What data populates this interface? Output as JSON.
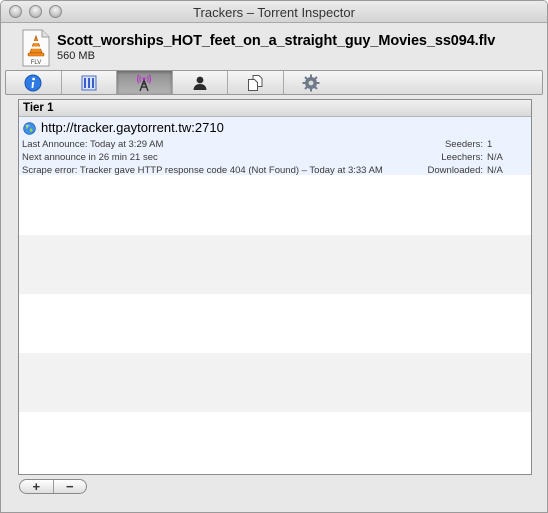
{
  "window": {
    "title": "Trackers – Torrent Inspector"
  },
  "file": {
    "icon": "flv-file-icon",
    "icon_label": "FLV",
    "name": "Scott_worships_HOT_feet_on_a_straight_guy_Movies_ss094.flv",
    "size": "560 MB"
  },
  "tabs": [
    {
      "icon": "info-icon",
      "selected": false
    },
    {
      "icon": "pieces-icon",
      "selected": false
    },
    {
      "icon": "tracker-antenna-icon",
      "selected": true
    },
    {
      "icon": "peers-icon",
      "selected": false
    },
    {
      "icon": "files-icon",
      "selected": false
    },
    {
      "icon": "gear-icon",
      "selected": false
    }
  ],
  "tier": {
    "label": "Tier 1"
  },
  "tracker": {
    "url": "http://tracker.gaytorrent.tw:2710",
    "last_announce": "Last Announce: Today at 3:29 AM",
    "next_announce": "Next announce in 26 min 21 sec",
    "scrape_error": "Scrape error: Tracker gave HTTP response code 404 (Not Found) – Today at 3:33 AM",
    "seeders_label": "Seeders:",
    "seeders_value": "1",
    "leechers_label": "Leechers:",
    "leechers_value": "N/A",
    "downloaded_label": "Downloaded:",
    "downloaded_value": "N/A"
  },
  "buttons": {
    "add_label": "+",
    "remove_label": "−"
  },
  "colors": {
    "selected_row": "#edf3fe",
    "alt_row": "#f2f2f2"
  }
}
